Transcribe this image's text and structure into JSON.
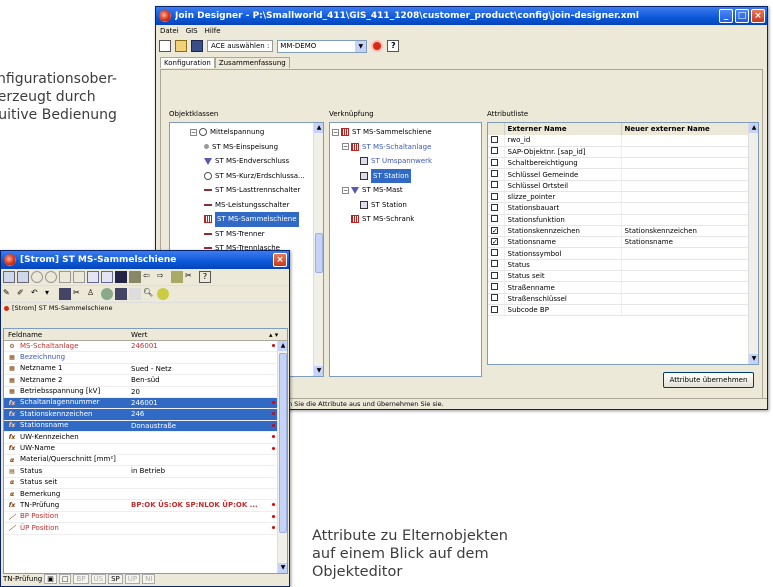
{
  "captions": {
    "top": [
      "Konfigurationsober-",
      "überzeugt durch",
      "intuitive Bedienung"
    ],
    "bottom": [
      "Attribute zu Elternobjekten",
      "auf einem Blick auf dem",
      "Objekteditor"
    ]
  },
  "join": {
    "title": "Join Designer - P:\\Smallworld_411\\GIS_411_1208\\customer_product\\config\\join-designer.xml",
    "menu": [
      "Datei",
      "GIS",
      "Hilfe"
    ],
    "ace_label": "ACE auswählen :",
    "ace_value": "MM-DEMO",
    "tabs": [
      "Konfiguration",
      "Zusammenfassung"
    ],
    "group_objektklassen": "Objektklassen",
    "group_verknuepfung": "Verknüpfung",
    "group_attributliste": "Attributliste",
    "objektklassen": [
      "Mittelspannung",
      "ST MS-Einspeisung",
      "ST MS-Endverschluss",
      "ST MS-Kurz/Erdschlussa...",
      "ST MS-Lasttrennschalter",
      "MS-Leistungsschalter",
      "ST MS-Sammelschiene",
      "ST MS-Trenner",
      "ST MS-Trennlasche"
    ],
    "verknuepfung": [
      "ST MS-Sammelschiene",
      "ST MS-Schaltanlage",
      "ST Umspannwerk",
      "ST Station",
      "ST MS-Mast",
      "ST Station",
      "ST MS-Schrank"
    ],
    "attr_headers": [
      "Externer Name",
      "Neuer externer Name"
    ],
    "attributes": [
      {
        "name": "rwo_id",
        "new": "",
        "checked": false
      },
      {
        "name": "SAP-Objektnr. [sap_id]",
        "new": "",
        "checked": false
      },
      {
        "name": "Schaltbereichtigung",
        "new": "",
        "checked": false
      },
      {
        "name": "Schlüssel Gemeinde",
        "new": "",
        "checked": false
      },
      {
        "name": "Schlüssel Ortsteil",
        "new": "",
        "checked": false
      },
      {
        "name": "slizze_pointer",
        "new": "",
        "checked": false
      },
      {
        "name": "Stationsbauart",
        "new": "",
        "checked": false
      },
      {
        "name": "Stationsfunktion",
        "new": "",
        "checked": false
      },
      {
        "name": "Stationskennzeichen",
        "new": "Stationskennzeichen",
        "checked": true
      },
      {
        "name": "Stationsname",
        "new": "Stationsname",
        "checked": true
      },
      {
        "name": "Stationssymbol",
        "new": "",
        "checked": false
      },
      {
        "name": "Status",
        "new": "",
        "checked": false
      },
      {
        "name": "Status seit",
        "new": "",
        "checked": false
      },
      {
        "name": "Straßenname",
        "new": "",
        "checked": false
      },
      {
        "name": "Straßenschlüssel",
        "new": "",
        "checked": false
      },
      {
        "name": "Subcode BP",
        "new": "",
        "checked": false
      }
    ],
    "apply_button": "Attribute übernehmen",
    "status_text": "n Sie die Attribute aus und übernehmen Sie sie."
  },
  "strom": {
    "title": "[Strom] ST MS-Sammelschiene",
    "breadcrumb": "[Strom] ST MS-Sammelschiene",
    "col_feldname": "Feldname",
    "col_wert": "Wert",
    "rows": [
      {
        "field": "MS-Schaltanlage",
        "value": "246001",
        "style": "red",
        "icon": "gear"
      },
      {
        "field": "Bezeichnung",
        "value": "",
        "style": "blue",
        "icon": "book"
      },
      {
        "field": "Netzname 1",
        "value": "Sued - Netz",
        "style": "",
        "icon": "book"
      },
      {
        "field": "Netzname 2",
        "value": "Ben-süd",
        "style": "",
        "icon": "book"
      },
      {
        "field": "Betriebsspannung [kV]",
        "value": "20",
        "style": "",
        "icon": "book"
      },
      {
        "field": "Schaltanlagennummer",
        "value": "246001",
        "style": "sel",
        "icon": "fx"
      },
      {
        "field": "Stationskennzeichen",
        "value": "246",
        "style": "sel",
        "icon": "fx"
      },
      {
        "field": "Stationsname",
        "value": "Donaustraße",
        "style": "sel",
        "icon": "fx"
      },
      {
        "field": "UW-Kennzeichen",
        "value": "",
        "style": "",
        "icon": "fx"
      },
      {
        "field": "UW-Name",
        "value": "",
        "style": "",
        "icon": "fx"
      },
      {
        "field": "Material/Querschnitt [mm²]",
        "value": "",
        "style": "",
        "icon": "alpha"
      },
      {
        "field": "Status",
        "value": "in Betrieb",
        "style": "",
        "icon": "list"
      },
      {
        "field": "Status seit",
        "value": "",
        "style": "",
        "icon": "alpha"
      },
      {
        "field": "Bemerkung",
        "value": "",
        "style": "",
        "icon": "alpha"
      },
      {
        "field": "TN-Prüfung",
        "value": "BP:OK ÜS:OK SP:NLOK ÜP:OK ...",
        "style": "redval",
        "icon": "fx"
      },
      {
        "field": "BP Position",
        "value": "",
        "style": "red",
        "icon": "pen"
      },
      {
        "field": "ÜP Position",
        "value": "",
        "style": "red",
        "icon": "pen"
      }
    ],
    "bottom": [
      "TN-Prüfung",
      "BP",
      "ÜS",
      "SP",
      "ÜP",
      "NI"
    ]
  }
}
